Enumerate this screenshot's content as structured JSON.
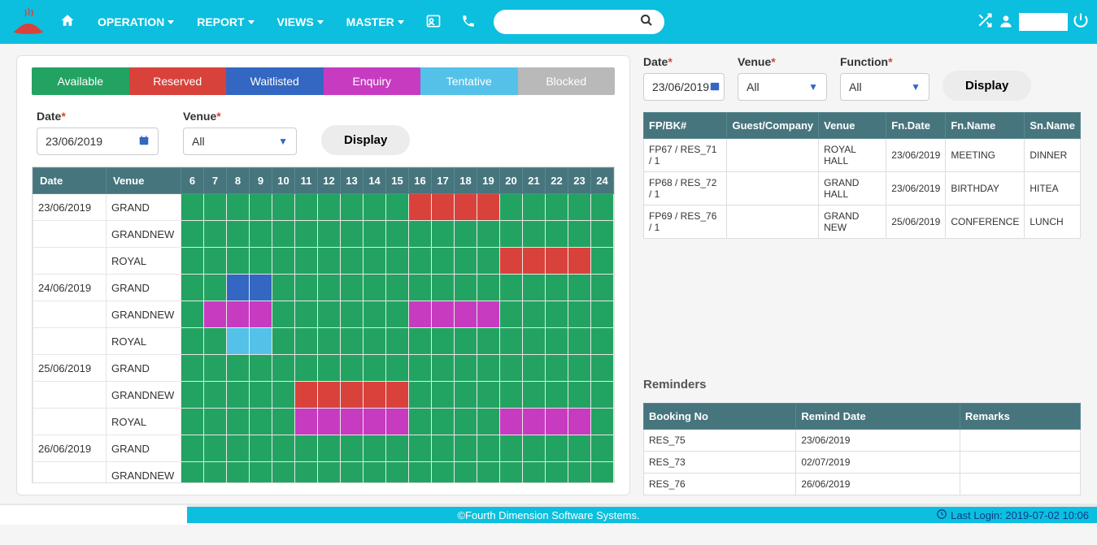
{
  "nav": {
    "operation": "OPERATION",
    "report": "REPORT",
    "views": "VIEWS",
    "master": "MASTER"
  },
  "legend": {
    "available": "Available",
    "reserved": "Reserved",
    "waitlisted": "Waitlisted",
    "enquiry": "Enquiry",
    "tentative": "Tentative",
    "blocked": "Blocked"
  },
  "leftFilter": {
    "dateLabel": "Date",
    "dateValue": "23/06/2019",
    "venueLabel": "Venue",
    "venueValue": "All",
    "displayBtn": "Display"
  },
  "gridHeaders": {
    "date": "Date",
    "venue": "Venue",
    "hours": [
      "6",
      "7",
      "8",
      "9",
      "10",
      "11",
      "12",
      "13",
      "14",
      "15",
      "16",
      "17",
      "18",
      "19",
      "20",
      "21",
      "22",
      "23",
      "24"
    ]
  },
  "gridRows": [
    {
      "date": "23/06/2019",
      "venue": "GRAND",
      "cells": [
        "a",
        "a",
        "a",
        "a",
        "a",
        "a",
        "a",
        "a",
        "a",
        "a",
        "r",
        "r",
        "r",
        "r",
        "a",
        "a",
        "a",
        "a",
        "a"
      ]
    },
    {
      "date": "",
      "venue": "GRANDNEW",
      "cells": [
        "a",
        "a",
        "a",
        "a",
        "a",
        "a",
        "a",
        "a",
        "a",
        "a",
        "a",
        "a",
        "a",
        "a",
        "a",
        "a",
        "a",
        "a",
        "a"
      ]
    },
    {
      "date": "",
      "venue": "ROYAL",
      "cells": [
        "a",
        "a",
        "a",
        "a",
        "a",
        "a",
        "a",
        "a",
        "a",
        "a",
        "a",
        "a",
        "a",
        "a",
        "r",
        "r",
        "r",
        "r",
        "a"
      ]
    },
    {
      "date": "24/06/2019",
      "venue": "GRAND",
      "cells": [
        "a",
        "a",
        "w",
        "w",
        "a",
        "a",
        "a",
        "a",
        "a",
        "a",
        "a",
        "a",
        "a",
        "a",
        "a",
        "a",
        "a",
        "a",
        "a"
      ]
    },
    {
      "date": "",
      "venue": "GRANDNEW",
      "cells": [
        "a",
        "e",
        "e",
        "e",
        "a",
        "a",
        "a",
        "a",
        "a",
        "a",
        "e",
        "e",
        "e",
        "e",
        "a",
        "a",
        "a",
        "a",
        "a"
      ]
    },
    {
      "date": "",
      "venue": "ROYAL",
      "cells": [
        "a",
        "a",
        "t",
        "t",
        "a",
        "a",
        "a",
        "a",
        "a",
        "a",
        "a",
        "a",
        "a",
        "a",
        "a",
        "a",
        "a",
        "a",
        "a"
      ]
    },
    {
      "date": "25/06/2019",
      "venue": "GRAND",
      "cells": [
        "a",
        "a",
        "a",
        "a",
        "a",
        "a",
        "a",
        "a",
        "a",
        "a",
        "a",
        "a",
        "a",
        "a",
        "a",
        "a",
        "a",
        "a",
        "a"
      ]
    },
    {
      "date": "",
      "venue": "GRANDNEW",
      "cells": [
        "a",
        "a",
        "a",
        "a",
        "a",
        "r",
        "r",
        "r",
        "r",
        "r",
        "a",
        "a",
        "a",
        "a",
        "a",
        "a",
        "a",
        "a",
        "a"
      ]
    },
    {
      "date": "",
      "venue": "ROYAL",
      "cells": [
        "a",
        "a",
        "a",
        "a",
        "a",
        "e",
        "e",
        "e",
        "e",
        "e",
        "a",
        "a",
        "a",
        "a",
        "e",
        "e",
        "e",
        "e",
        "a"
      ]
    },
    {
      "date": "26/06/2019",
      "venue": "GRAND",
      "cells": [
        "a",
        "a",
        "a",
        "a",
        "a",
        "a",
        "a",
        "a",
        "a",
        "a",
        "a",
        "a",
        "a",
        "a",
        "a",
        "a",
        "a",
        "a",
        "a"
      ]
    },
    {
      "date": "",
      "venue": "GRANDNEW",
      "cells": [
        "a",
        "a",
        "a",
        "a",
        "a",
        "a",
        "a",
        "a",
        "a",
        "a",
        "a",
        "a",
        "a",
        "a",
        "a",
        "a",
        "a",
        "a",
        "a"
      ]
    }
  ],
  "rightFilter": {
    "dateLabel": "Date",
    "dateValue": "23/06/2019",
    "venueLabel": "Venue",
    "venueValue": "All",
    "functionLabel": "Function",
    "functionValue": "All",
    "displayBtn": "Display"
  },
  "bookingTable": {
    "headers": [
      "FP/BK#",
      "Guest/Company",
      "Venue",
      "Fn.Date",
      "Fn.Name",
      "Sn.Name"
    ],
    "rows": [
      [
        "FP67 / RES_71 / 1",
        "",
        "ROYAL HALL",
        "23/06/2019",
        "MEETING",
        "DINNER"
      ],
      [
        "FP68 / RES_72 / 1",
        "",
        "GRAND HALL",
        "23/06/2019",
        "BIRTHDAY",
        "HITEA"
      ],
      [
        "FP69 / RES_76 / 1",
        "",
        "GRAND NEW",
        "25/06/2019",
        "CONFERENCE",
        "LUNCH"
      ]
    ]
  },
  "reminders": {
    "title": "Reminders",
    "headers": [
      "Booking No",
      "Remind Date",
      "Remarks"
    ],
    "rows": [
      [
        "RES_75",
        "23/06/2019",
        ""
      ],
      [
        "RES_73",
        "02/07/2019",
        ""
      ],
      [
        "RES_76",
        "26/06/2019",
        ""
      ]
    ]
  },
  "footer": {
    "center": "©Fourth Dimension Software Systems.",
    "lastLogin": "Last Login: 2019-07-02 10:06"
  }
}
